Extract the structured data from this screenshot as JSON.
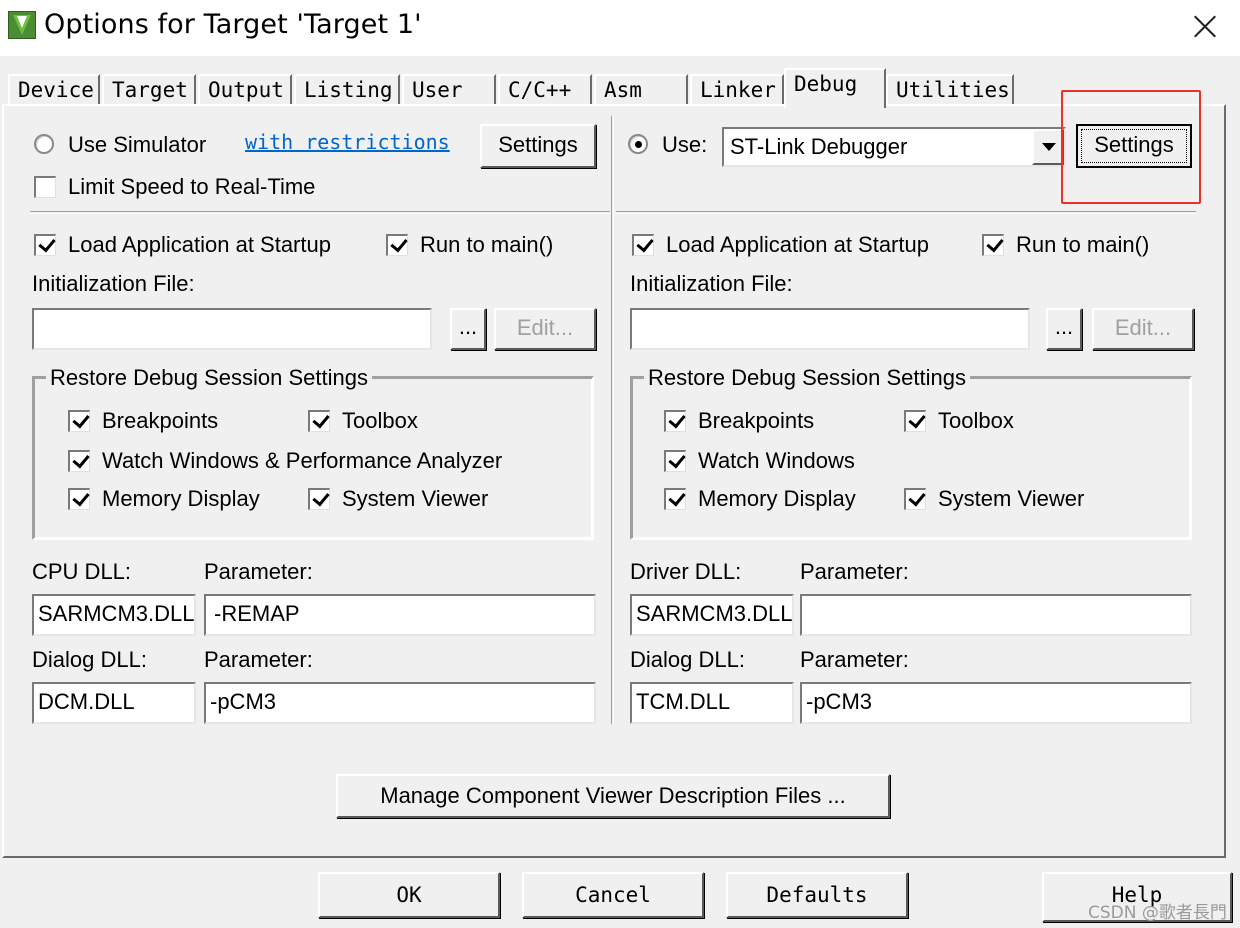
{
  "window": {
    "title": "Options for Target 'Target 1'",
    "icon": "keil-uvision-icon",
    "close_glyph": "close-icon"
  },
  "tabs": [
    "Device",
    "Target",
    "Output",
    "Listing",
    "User",
    "C/C++",
    "Asm",
    "Linker",
    "Debug",
    "Utilities"
  ],
  "active_tab": "Debug",
  "left": {
    "use_simulator_label": "Use Simulator",
    "use_simulator_selected": false,
    "restrictions_link": "with restrictions",
    "settings_label": "Settings",
    "limit_speed_label": "Limit Speed to Real-Time",
    "limit_speed_checked": false,
    "load_app_label": "Load Application at Startup",
    "load_app_checked": true,
    "run_main_label": "Run to main()",
    "run_main_checked": true,
    "init_file_label": "Initialization File:",
    "init_file_value": "",
    "browse_label": "...",
    "edit_label": "Edit...",
    "restore_group_title": "Restore Debug Session Settings",
    "breakpoints_label": "Breakpoints",
    "toolbox_label": "Toolbox",
    "watch_label": "Watch Windows & Performance Analyzer",
    "memory_label": "Memory Display",
    "sysviewer_label": "System Viewer",
    "cpu_dll_label": "CPU DLL:",
    "cpu_dll_value": "SARMCM3.DLL",
    "cpu_param_label": "Parameter:",
    "cpu_param_value": "-REMAP",
    "dialog_dll_label": "Dialog DLL:",
    "dialog_dll_value": "DCM.DLL",
    "dialog_param_label": "Parameter:",
    "dialog_param_value": "-pCM3"
  },
  "right": {
    "use_label": "Use:",
    "use_selected": true,
    "debugger_value": "ST-Link Debugger",
    "settings_label": "Settings",
    "load_app_label": "Load Application at Startup",
    "load_app_checked": true,
    "run_main_label": "Run to main()",
    "run_main_checked": true,
    "init_file_label": "Initialization File:",
    "init_file_value": "",
    "browse_label": "...",
    "edit_label": "Edit...",
    "restore_group_title": "Restore Debug Session Settings",
    "breakpoints_label": "Breakpoints",
    "toolbox_label": "Toolbox",
    "watch_label": "Watch Windows",
    "memory_label": "Memory Display",
    "sysviewer_label": "System Viewer",
    "driver_dll_label": "Driver DLL:",
    "driver_dll_value": "SARMCM3.DLL",
    "driver_param_label": "Parameter:",
    "driver_param_value": "",
    "dialog_dll_label": "Dialog DLL:",
    "dialog_dll_value": "TCM.DLL",
    "dialog_param_label": "Parameter:",
    "dialog_param_value": "-pCM3"
  },
  "manage_button_label": "Manage Component Viewer Description Files ...",
  "footer": {
    "ok_label": "OK",
    "cancel_label": "Cancel",
    "defaults_label": "Defaults",
    "help_label": "Help"
  },
  "watermark": "CSDN @歌者長門",
  "colors": {
    "dialog_bg": "#f0f0f0",
    "highlight": "#e8322a",
    "link": "#0066cc"
  }
}
